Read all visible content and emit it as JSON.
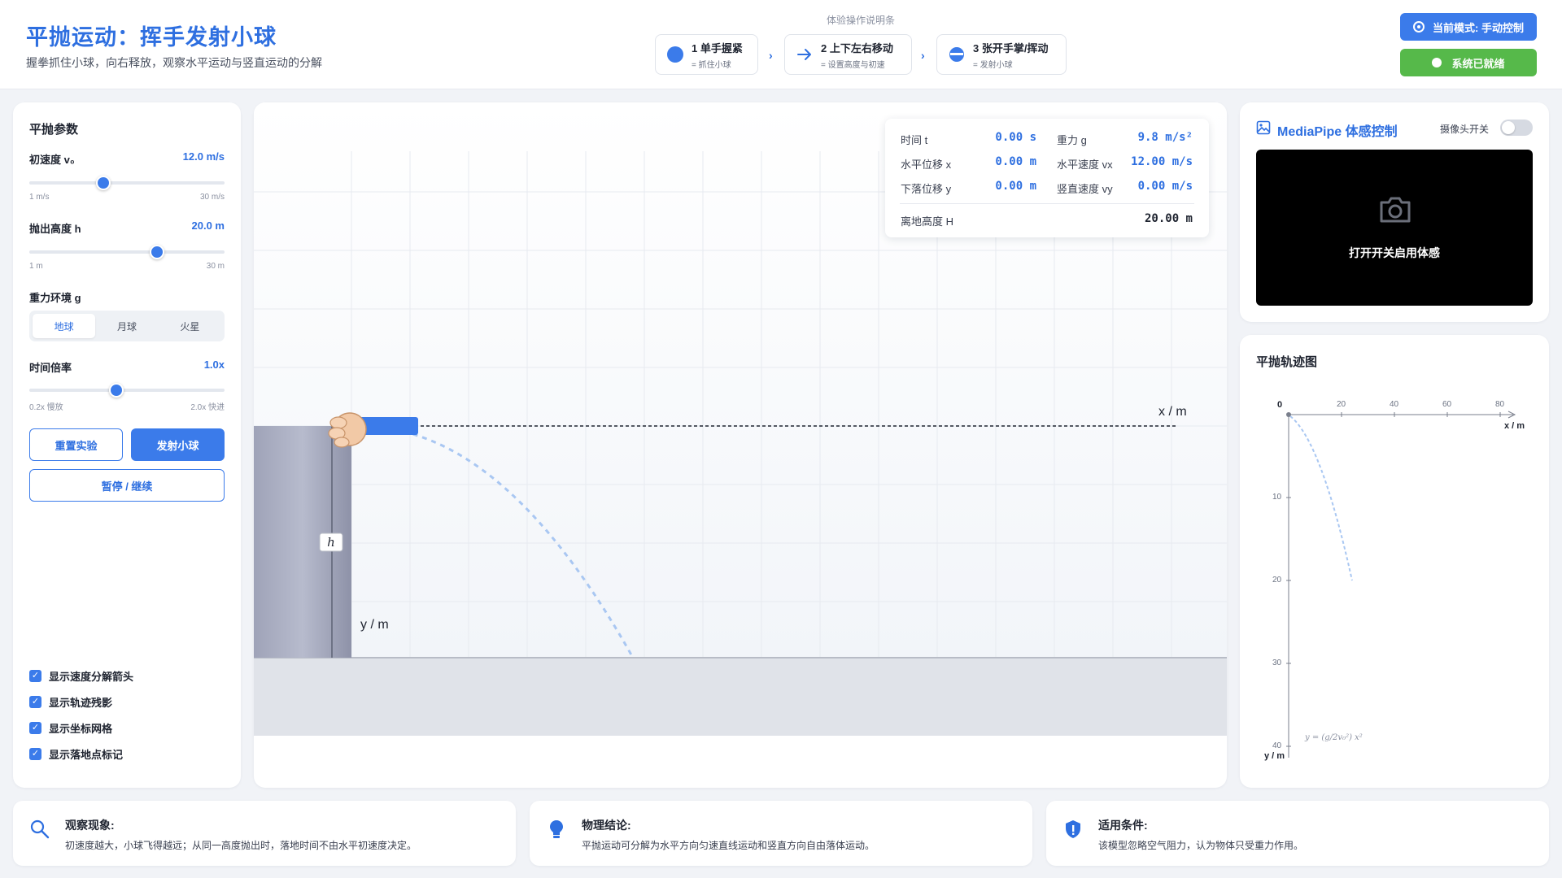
{
  "header": {
    "title": "平抛运动：挥手发射小球",
    "subtitle": "握拳抓住小球，向右释放，观察水平运动与竖直运动的分解",
    "guide_title": "体验操作说明条",
    "steps": [
      {
        "name": "1 单手握紧",
        "sub": "= 抓住小球"
      },
      {
        "name": "2 上下左右移动",
        "sub": "= 设置高度与初速"
      },
      {
        "name": "3 张开手掌/挥动",
        "sub": "= 发射小球"
      }
    ],
    "step_arrow": "›",
    "mode_label": "当前模式: 手动控制",
    "status_label": "系统已就绪",
    "colors": {
      "accent": "#3b7bea",
      "ready": "#56b94a"
    }
  },
  "params": {
    "title": "平抛参数",
    "velocity": {
      "label": "初速度 v₀",
      "value": "12.0 m/s",
      "min": "1 m/s",
      "max": "30 m/s",
      "ratio": 0.3793
    },
    "height": {
      "label": "抛出高度 h",
      "value": "20.0 m",
      "min": "1 m",
      "max": "30 m",
      "ratio": 0.6552
    },
    "gravity": {
      "label": "重力环境 g",
      "options": [
        "地球",
        "月球",
        "火星"
      ],
      "selected": "地球"
    },
    "time_scale": {
      "label": "时间倍率",
      "value": "1.0x",
      "min": "0.2x 慢放",
      "max": "2.0x 快进",
      "ratio": 0.4444
    },
    "reset_label": "重置实验",
    "launch_label": "发射小球",
    "pause_label": "暂停 / 继续",
    "checkboxes": [
      {
        "label": "显示速度分解箭头",
        "checked": true
      },
      {
        "label": "显示轨迹残影",
        "checked": true
      },
      {
        "label": "显示坐标网格",
        "checked": true
      },
      {
        "label": "显示落地点标记",
        "checked": true
      }
    ]
  },
  "sim": {
    "x_axis_label": "x / m",
    "y_axis_label": "y / m",
    "height_marker": "h",
    "readout": {
      "time_label": "时间 t",
      "time_value": "0.00 s",
      "gravity_label": "重力 g",
      "gravity_value": "9.8 m/s²",
      "x_label": "水平位移 x",
      "x_value": "0.00 m",
      "vx_label": "水平速度 vx",
      "vx_value": "12.00 m/s",
      "y_label": "下落位移 y",
      "y_value": "0.00 m",
      "vy_label": "竖直速度 vy",
      "vy_value": "0.00 m/s",
      "H_label": "离地高度 H",
      "H_value": "20.00 m"
    }
  },
  "camera": {
    "title": "MediaPipe 体感控制",
    "switch_label": "摄像头开关",
    "switch_on": false,
    "message": "打开开关启用体感"
  },
  "trajectory": {
    "title": "平抛轨迹图",
    "origin_label": "0",
    "x_ticks": [
      "20",
      "40",
      "60",
      "80"
    ],
    "y_ticks": [
      "10",
      "20",
      "30",
      "40"
    ],
    "x_label": "x / m",
    "y_label": "y / m",
    "formula": "y = (g/2v₀²) x²"
  },
  "info": [
    {
      "title": "观察现象:",
      "text": "初速度越大，小球飞得越远；从同一高度抛出时，落地时间不由水平初速度决定。",
      "icon": "search-icon"
    },
    {
      "title": "物理结论:",
      "text": "平抛运动可分解为水平方向匀速直线运动和竖直方向自由落体运动。",
      "icon": "lightbulb-icon"
    },
    {
      "title": "适用条件:",
      "text": "该模型忽略空气阻力，认为物体只受重力作用。",
      "icon": "shield-icon"
    }
  ]
}
